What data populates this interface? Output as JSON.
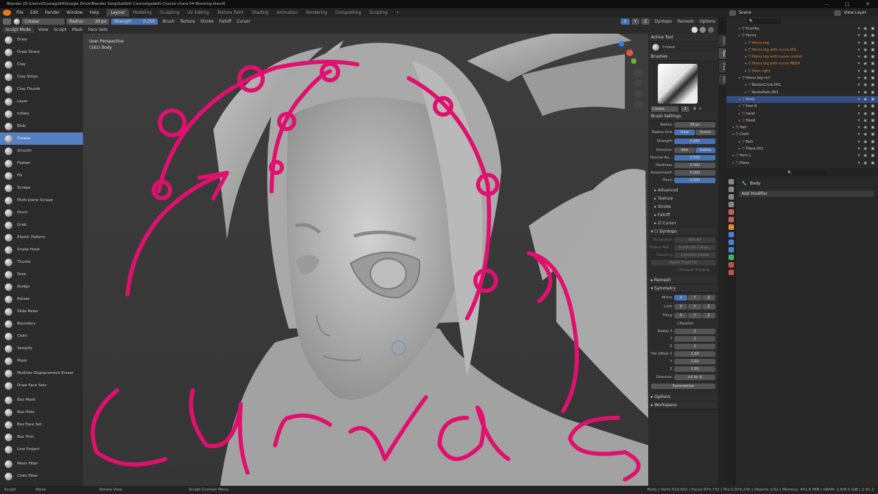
{
  "window": {
    "title": "Blender [D:\\Users\\D\\seragz99\\Google Drive\\Blender Serg\\Gabbitt Course\\gabbitt Course chara 04 Blocking.blend]",
    "controls": [
      "–",
      "□",
      "✕"
    ]
  },
  "menu": {
    "items": [
      "File",
      "Edit",
      "Render",
      "Window",
      "Help"
    ],
    "workspaces": [
      "Layout",
      "Modeling",
      "Sculpting",
      "UV Editing",
      "Texture Paint",
      "Shading",
      "Animation",
      "Rendering",
      "Compositing",
      "Scripting"
    ],
    "add_tab": "+",
    "scene": "Scene",
    "view_layer": "View Layer"
  },
  "tool_header": {
    "brush_name": "Crease",
    "radius_label": "Radius",
    "radius_value": "39 px",
    "strength_label": "Strength",
    "strength_value": "0.250",
    "menus": [
      "Brush",
      "Texture",
      "Stroke",
      "Falloff",
      "Cursor"
    ],
    "axes": [
      "X",
      "Y",
      "Z"
    ],
    "dyntopo": "Dyntopo",
    "remesh": "Remesh",
    "options": "Options"
  },
  "mode_header": {
    "mode": "Sculpt Mode",
    "menus": [
      "View",
      "Sculpt",
      "Mask",
      "Face Sets"
    ]
  },
  "tools": [
    "Draw",
    "Draw Sharp",
    "Clay",
    "Clay Strips",
    "Clay Thumb",
    "Layer",
    "Inflate",
    "Blob",
    "Crease",
    "Smooth",
    "Flatten",
    "Fill",
    "Scrape",
    "Multi-plane Scrape",
    "Pinch",
    "Grab",
    "Elastic Deform",
    "Snake Hook",
    "Thumb",
    "Pose",
    "Nudge",
    "Rotate",
    "Slide Relax",
    "Boundary",
    "Cloth",
    "Simplify",
    "Mask",
    "Multires Displacement Eraser",
    "Draw Face Sets"
  ],
  "tools2": [
    "Box Mask",
    "Box Hide",
    "Box Face Set",
    "Box Trim",
    "Line Project"
  ],
  "tools3": [
    "Mesh Filter",
    "Cloth Filter"
  ],
  "active_tool": "Crease",
  "viewport": {
    "perspective": "User Perspective",
    "object": "(161) Body",
    "annotation": "Curvas"
  },
  "npanel": {
    "active_tool_title": "Active Tool",
    "active_tool_name": "Crease",
    "brushes_title": "Brushes",
    "brush_name": "Crease",
    "brush_users": "2",
    "brush_settings_title": "Brush Settings",
    "radius_label": "Radius",
    "radius": "39 px",
    "radius_unit_label": "Radius Unit",
    "radius_unit_view": "View",
    "radius_unit_scene": "Scene",
    "strength_label": "Strength",
    "strength": "0.250",
    "direction_label": "Direction",
    "dir_add": "Add",
    "dir_sub": "Subtra",
    "normal_radius_label": "Normal Ra...",
    "normal_radius": "0.500",
    "hardness_label": "Hardness",
    "hardness": "0.000",
    "autosmooth_label": "Autosmooth",
    "autosmooth": "0.000",
    "pinch_label": "Pinch",
    "pinch": "0.500",
    "subpanels": [
      "Advanced",
      "Texture",
      "Stroke",
      "Falloff",
      "Cursor"
    ],
    "dyntopo_title": "Dyntopo",
    "resolution_label": "Resolution",
    "resolution": "800.40",
    "refine_label": "Refine Met...",
    "refine_value": "Subdivide Collap...",
    "detailing_label": "Detailing",
    "detailing_value": "Constant Detail",
    "detail_flood": "Detail Flood Fill",
    "smooth_shading": "Smooth Shading",
    "remesh_title": "Remesh",
    "symmetry_title": "Symmetry",
    "mirror_label": "Mirror",
    "lock_label": "Lock",
    "tiling_label": "Tiling",
    "xyz": [
      "X",
      "Y",
      "Z"
    ],
    "feather": "Feather",
    "radial_x_label": "Radial X",
    "radial_x": "1",
    "y_label": "Y",
    "radial_y": "1",
    "z_label": "Z",
    "radial_z": "1",
    "tile_offset_label": "Tile Offset X",
    "tile_x": "1.00",
    "tile_y": "1.00",
    "tile_z": "1.00",
    "direction2_label": "Direction",
    "direction2": "+X to -X",
    "symmetrize": "Symmetrize",
    "options_title": "Options",
    "workspace_title": "Workspace"
  },
  "vtabs": [
    "Item",
    "Tool",
    "View",
    "Edit"
  ],
  "outliner": {
    "rows": [
      "thumbs",
      "Horns",
      "Horns big",
      "Horns big with curve.001",
      "Horns big with curve control",
      "Horns big with curve MESH",
      "Horn right",
      "Horns big ctrl",
      "BezierCircle.001",
      "NurbsPath.003",
      "Body",
      "Feet.R",
      "hand",
      "Head",
      "Hair",
      "Cloth",
      "Belt",
      "Plane.001",
      "Horn L",
      "Plane"
    ],
    "selected": "Body"
  },
  "properties": {
    "object": "Body",
    "add_modifier": "Add Modifier"
  },
  "statusbar": {
    "left": [
      "Sculpt",
      "Move",
      "Rotate View",
      "Sculpt Context Menu"
    ],
    "stats": "Body | Verts:510,602 | Faces:970,732 | Tris:1,019,245 | Objects:1/32 | Memory: 401.8 MiB | VRAM: 2.6/8.0 GiB | 2.91.2"
  },
  "colors": {
    "accent": "#4772b3",
    "annotation": "#e0116e",
    "panel": "#2b2b2b",
    "viewport": "#3a3a3a"
  }
}
